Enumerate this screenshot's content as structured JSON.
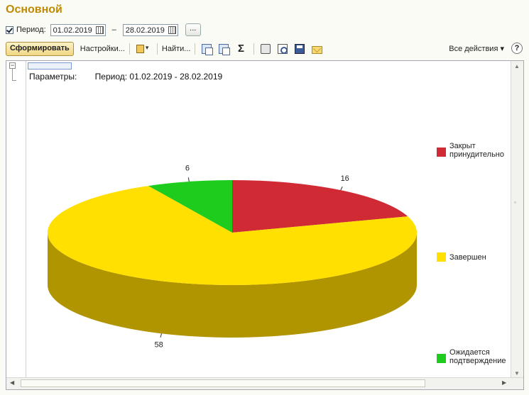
{
  "header": {
    "title": "Основной"
  },
  "period": {
    "label": "Период:",
    "from": "01.02.2019",
    "separator": "–",
    "to": "28.02.2019",
    "more_label": "..."
  },
  "toolbar": {
    "generate": "Сформировать",
    "settings": "Настройки...",
    "find": "Найти...",
    "sum_symbol": "Σ",
    "all_actions": "Все действия ▾",
    "help": "?"
  },
  "report": {
    "params_label": "Параметры:",
    "params_value": "Период: 01.02.2019 - 28.02.2019"
  },
  "chart_data": {
    "type": "pie",
    "categories": [
      "Закрыт принудительно",
      "Завершен",
      "Ожидается подтверждение"
    ],
    "values": [
      16,
      58,
      6
    ],
    "colors": [
      "#d02a35",
      "#ffe000",
      "#1dcc1d"
    ],
    "side_colors": [
      "#8a1a20",
      "#b09400",
      "#118a11"
    ],
    "legend_lines": [
      [
        "Закрыт",
        "принудительно"
      ],
      [
        "Завершен"
      ],
      [
        "Ожидается",
        "подтверждение"
      ]
    ],
    "legend_position": "right",
    "style": "3d"
  }
}
